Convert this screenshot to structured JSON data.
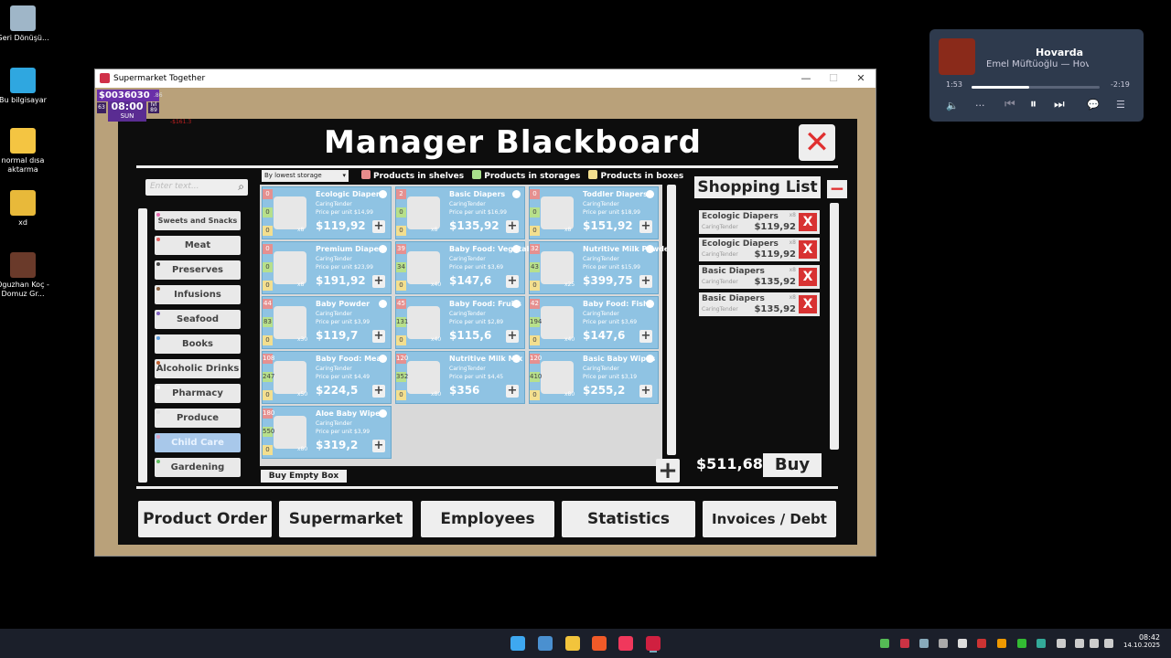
{
  "desktop": {
    "icons": [
      {
        "label": "Geri Dönüşü...",
        "icon": "recycle-bin-icon"
      },
      {
        "label": "Bu bilgisayar",
        "icon": "computer-icon"
      },
      {
        "label": "normal dısa aktarma",
        "icon": "folder-icon"
      },
      {
        "label": "xd",
        "icon": "folder-icon"
      },
      {
        "label": "Oguzhan Koç - Domuz Gr...",
        "icon": "video-file-icon"
      }
    ]
  },
  "window": {
    "title": "Supermarket Together",
    "minimize": "—",
    "maximize": "☐",
    "close": "✕"
  },
  "hud": {
    "money": "$0036030",
    "money_sub": ".86",
    "time": "08:00",
    "day": "SUN",
    "left_num": "63",
    "right_num": "89",
    "lvl": "lvl",
    "red_text": "-$161.3"
  },
  "board": {
    "title": "Manager Blackboard",
    "close": "✕",
    "search_placeholder": "Enter text...",
    "sort_select": "By lowest storage",
    "legend": [
      {
        "label": "Products in shelves",
        "color": "#e88b8b"
      },
      {
        "label": "Products in storages",
        "color": "#a8e08b"
      },
      {
        "label": "Products in boxes",
        "color": "#f3df8f"
      }
    ],
    "categories": [
      {
        "label": "Sweets and Snacks",
        "dot": "#e66bb0",
        "active": false
      },
      {
        "label": "Meat",
        "dot": "#e06060",
        "active": false
      },
      {
        "label": "Preserves",
        "dot": "#444444",
        "active": false
      },
      {
        "label": "Infusions",
        "dot": "#8a6040",
        "active": false
      },
      {
        "label": "Seafood",
        "dot": "#8060c0",
        "active": false
      },
      {
        "label": "Books",
        "dot": "#60a0e0",
        "active": false
      },
      {
        "label": "Alcoholic Drinks",
        "dot": "#c06030",
        "active": false
      },
      {
        "label": "Pharmacy",
        "dot": "#ffffff",
        "active": false
      },
      {
        "label": "Produce",
        "dot": "#e0e0e0",
        "active": false
      },
      {
        "label": "Child Care",
        "dot": "#e0a0c0",
        "active": true
      },
      {
        "label": "Gardening",
        "dot": "#60c060",
        "active": false
      }
    ],
    "products": [
      {
        "name": "Ecologic Diapers",
        "brand": "CaringTender",
        "ppu": "Price per unit $14,99",
        "price": "$119,92",
        "shelves": "0",
        "storage": "0",
        "boxes": "0",
        "mult": "x8"
      },
      {
        "name": "Basic Diapers",
        "brand": "CaringTender",
        "ppu": "Price per unit $16,99",
        "price": "$135,92",
        "shelves": "2",
        "storage": "0",
        "boxes": "0",
        "mult": "x8"
      },
      {
        "name": "Toddler Diapers",
        "brand": "CaringTender",
        "ppu": "Price per unit $18,99",
        "price": "$151,92",
        "shelves": "0",
        "storage": "0",
        "boxes": "0",
        "mult": "x8"
      },
      {
        "name": "Premium Diapers",
        "brand": "CaringTender",
        "ppu": "Price per unit $23,99",
        "price": "$191,92",
        "shelves": "0",
        "storage": "0",
        "boxes": "0",
        "mult": "x8"
      },
      {
        "name": "Baby Food: Vegetables",
        "brand": "CaringTender",
        "ppu": "Price per unit $3,69",
        "price": "$147,6",
        "shelves": "39",
        "storage": "34",
        "boxes": "0",
        "mult": "x40"
      },
      {
        "name": "Nutritive Milk Powder",
        "brand": "CaringTender",
        "ppu": "Price per unit $15,99",
        "price": "$399,75",
        "shelves": "32",
        "storage": "43",
        "boxes": "0",
        "mult": "x25"
      },
      {
        "name": "Baby Powder",
        "brand": "CaringTender",
        "ppu": "Price per unit $3,99",
        "price": "$119,7",
        "shelves": "44",
        "storage": "83",
        "boxes": "0",
        "mult": "x30"
      },
      {
        "name": "Baby Food: Fruits",
        "brand": "CaringTender",
        "ppu": "Price per unit $2,89",
        "price": "$115,6",
        "shelves": "45",
        "storage": "131",
        "boxes": "0",
        "mult": "x40"
      },
      {
        "name": "Baby Food: Fish",
        "brand": "CaringTender",
        "ppu": "Price per unit $3,69",
        "price": "$147,6",
        "shelves": "42",
        "storage": "194",
        "boxes": "0",
        "mult": "x40"
      },
      {
        "name": "Baby Food: Meat",
        "brand": "CaringTender",
        "ppu": "Price per unit $4,49",
        "price": "$224,5",
        "shelves": "108",
        "storage": "247",
        "boxes": "0",
        "mult": "x50"
      },
      {
        "name": "Nutritive Milk Mix",
        "brand": "CaringTender",
        "ppu": "Price per unit $4,45",
        "price": "$356",
        "shelves": "120",
        "storage": "352",
        "boxes": "0",
        "mult": "x80"
      },
      {
        "name": "Basic Baby Wipes",
        "brand": "CaringTender",
        "ppu": "Price per unit $3,19",
        "price": "$255,2",
        "shelves": "120",
        "storage": "410",
        "boxes": "0",
        "mult": "x80"
      },
      {
        "name": "Aloe Baby Wipes",
        "brand": "CaringTender",
        "ppu": "Price per unit $3,99",
        "price": "$319,2",
        "shelves": "180",
        "storage": "550",
        "boxes": "0",
        "mult": "x80"
      }
    ],
    "plus": "+",
    "buy_empty_box": "Buy Empty Box",
    "shopping_list_title": "Shopping List",
    "shopping_minus": "−",
    "shopping_items": [
      {
        "name": "Ecologic Diapers",
        "brand": "CaringTender",
        "price": "$119,92",
        "mult": "x8"
      },
      {
        "name": "Ecologic Diapers",
        "brand": "CaringTender",
        "price": "$119,92",
        "mult": "x8"
      },
      {
        "name": "Basic Diapers",
        "brand": "CaringTender",
        "price": "$135,92",
        "mult": "x8"
      },
      {
        "name": "Basic Diapers",
        "brand": "CaringTender",
        "price": "$135,92",
        "mult": "x8"
      }
    ],
    "remove": "X",
    "total": "$511,68",
    "buy": "Buy",
    "big_plus": "+",
    "tabs": [
      "Product Order",
      "Supermarket",
      "Employees",
      "Statistics",
      "Invoices / Debt"
    ]
  },
  "media": {
    "title": "Hovarda",
    "artist": "Emel Müftüoğlu — Hovarda",
    "elapsed": "1:53",
    "remaining": "-2:19",
    "progress": 0.45,
    "more": "···"
  },
  "taskbar": {
    "time": "08:42",
    "date": "14.10.2025"
  }
}
